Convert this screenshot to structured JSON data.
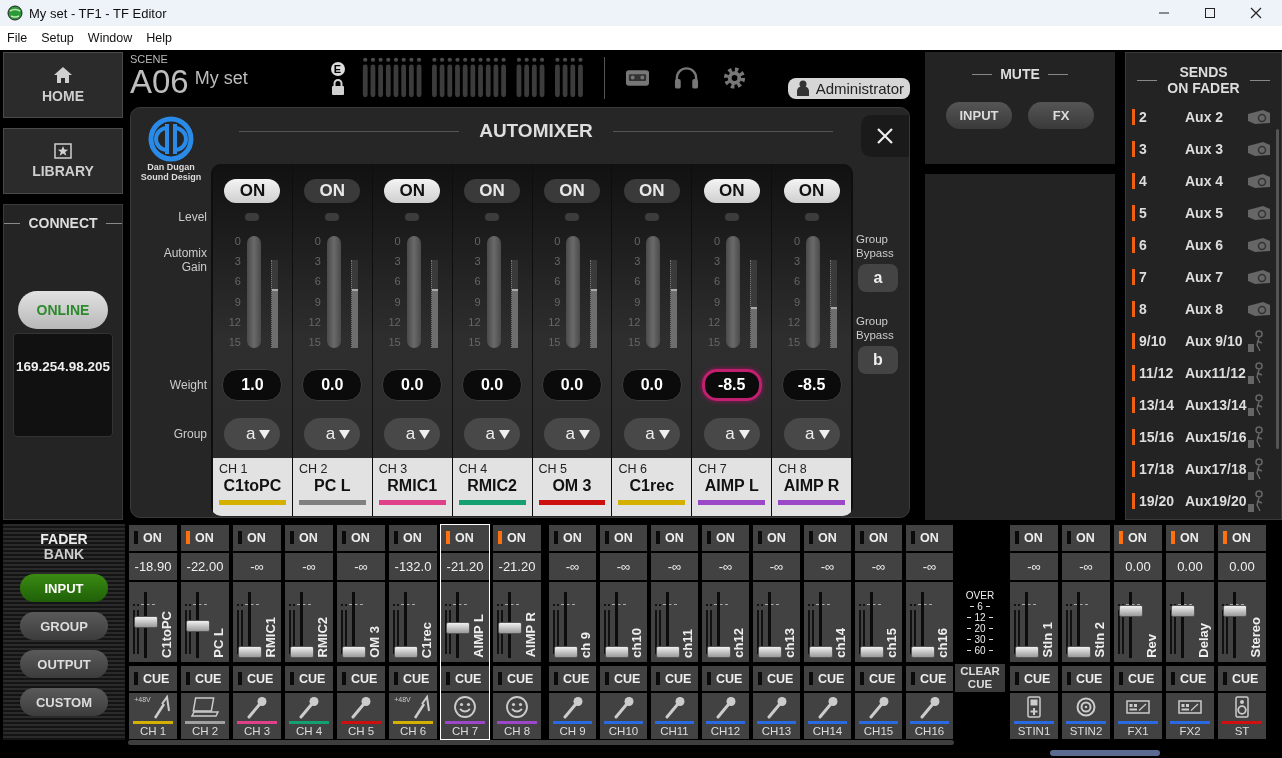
{
  "window": {
    "title": "My set - TF1 - TF Editor"
  },
  "menu": [
    "File",
    "Setup",
    "Window",
    "Help"
  ],
  "nav": [
    {
      "label": "HOME",
      "kind": "home"
    },
    {
      "label": "LIBRARY",
      "kind": "library"
    }
  ],
  "connect": {
    "title": "CONNECT",
    "button": "ONLINE",
    "address": "169.254.98.205"
  },
  "scene": {
    "label": "SCENE",
    "number": "A06",
    "name": "My set",
    "badge": "E"
  },
  "user": {
    "label": "Administrator"
  },
  "automixer": {
    "title": "AUTOMIXER",
    "logo_lines": [
      "Dan Dugan",
      "Sound Design"
    ],
    "row_labels": [
      "Level",
      "Automix Gain",
      "Weight",
      "Group"
    ],
    "channels": [
      {
        "button": "ON",
        "on": true,
        "scale": [
          "0",
          "3",
          "6",
          "9",
          "12",
          "15"
        ],
        "meter": {
          "level": 0.67
        },
        "weight": "1.0",
        "selected": false,
        "group": "a",
        "number": "CH 1",
        "name": "C1toPC",
        "color": "#d4b000"
      },
      {
        "button": "ON",
        "on": false,
        "scale": [
          "0",
          "3",
          "6",
          "9",
          "12",
          "15"
        ],
        "meter": {
          "level": 0.67
        },
        "weight": "0.0",
        "selected": false,
        "group": "a",
        "number": "CH 2",
        "name": "PC L",
        "color": "#808080"
      },
      {
        "button": "ON",
        "on": true,
        "scale": [
          "0",
          "3",
          "6",
          "9",
          "12",
          "15"
        ],
        "meter": {
          "level": 0.67
        },
        "weight": "0.0",
        "selected": false,
        "group": "a",
        "number": "CH 3",
        "name": "RMIC1",
        "color": "#e0408a"
      },
      {
        "button": "ON",
        "on": false,
        "scale": [
          "0",
          "3",
          "6",
          "9",
          "12",
          "15"
        ],
        "meter": {
          "level": 0.67
        },
        "weight": "0.0",
        "selected": false,
        "group": "a",
        "number": "CH 4",
        "name": "RMIC2",
        "color": "#14a070"
      },
      {
        "button": "ON",
        "on": false,
        "scale": [
          "0",
          "3",
          "6",
          "9",
          "12",
          "15"
        ],
        "meter": {
          "level": 0.67
        },
        "weight": "0.0",
        "selected": false,
        "group": "a",
        "number": "CH 5",
        "name": "OM 3",
        "color": "#cc1010"
      },
      {
        "button": "ON",
        "on": false,
        "scale": [
          "0",
          "3",
          "6",
          "9",
          "12",
          "15"
        ],
        "meter": {
          "level": 0.67
        },
        "weight": "0.0",
        "selected": false,
        "group": "a",
        "number": "CH 6",
        "name": "C1rec",
        "color": "#d4b000"
      },
      {
        "button": "ON",
        "on": true,
        "scale": [
          "0",
          "3",
          "6",
          "9",
          "12",
          "15"
        ],
        "meter": {
          "level": 0.47
        },
        "weight": "-8.5",
        "selected": true,
        "group": "a",
        "number": "CH 7",
        "name": "AIMP L",
        "color": "#9a48c8"
      },
      {
        "button": "ON",
        "on": true,
        "scale": [
          "0",
          "3",
          "6",
          "9",
          "12",
          "15"
        ],
        "meter": {
          "level": 0.47
        },
        "weight": "-8.5",
        "selected": false,
        "group": "a",
        "number": "CH 8",
        "name": "AIMP R",
        "color": "#9a48c8"
      }
    ],
    "bypass": [
      {
        "label": "Group Bypass",
        "button": "a"
      },
      {
        "label": "Group Bypass",
        "button": "b"
      }
    ]
  },
  "mute": {
    "title": "MUTE",
    "buttons": [
      "INPUT",
      "FX"
    ]
  },
  "sends": {
    "title": [
      "SENDS",
      "ON FADER"
    ],
    "items": [
      {
        "number": "2",
        "name": "Aux 2",
        "kind": "wedge"
      },
      {
        "number": "3",
        "name": "Aux 3",
        "kind": "wedge"
      },
      {
        "number": "4",
        "name": "Aux 4",
        "kind": "wedge"
      },
      {
        "number": "5",
        "name": "Aux 5",
        "kind": "wedge"
      },
      {
        "number": "6",
        "name": "Aux 6",
        "kind": "wedge"
      },
      {
        "number": "7",
        "name": "Aux 7",
        "kind": "wedge"
      },
      {
        "number": "8",
        "name": "Aux 8",
        "kind": "wedge"
      },
      {
        "number": "9/10",
        "name": "Aux 9/10",
        "kind": "iem"
      },
      {
        "number": "11/12",
        "name": "Aux11/12",
        "kind": "iem"
      },
      {
        "number": "13/14",
        "name": "Aux13/14",
        "kind": "iem"
      },
      {
        "number": "15/16",
        "name": "Aux15/16",
        "kind": "iem"
      },
      {
        "number": "17/18",
        "name": "Aux17/18",
        "kind": "iem"
      },
      {
        "number": "19/20",
        "name": "Aux19/20",
        "kind": "iem"
      }
    ]
  },
  "fader_bank": {
    "title": [
      "FADER",
      "BANK"
    ],
    "buttons": [
      {
        "label": "INPUT",
        "selected": true
      },
      {
        "label": "GROUP",
        "selected": false
      },
      {
        "label": "OUTPUT",
        "selected": false
      },
      {
        "label": "CUSTOM",
        "selected": false
      }
    ]
  },
  "meter_scale": [
    "OVER",
    "6",
    "12",
    "20",
    "30",
    "60"
  ],
  "clear_cue": "CLEAR CUE",
  "strip_banks": [
    {
      "strips": [
        {
          "on_label": "ON",
          "on": false,
          "value": "-18.90",
          "level": 0.55,
          "name": "C1toPC",
          "cue_label": "CUE",
          "cued": false,
          "kind": "phantom-mic",
          "phantom": "+48V",
          "color": "#d4b000",
          "label": "CH 1",
          "selected": false
        },
        {
          "on_label": "ON",
          "on": true,
          "value": "-22.00",
          "level": 0.48,
          "name": "PC L",
          "cue_label": "CUE",
          "cued": false,
          "kind": "laptop",
          "color": "#a0a0a0",
          "label": "CH 2",
          "selected": false
        },
        {
          "on_label": "ON",
          "on": false,
          "value": "-∞",
          "level": 0,
          "name": "RMIC1",
          "cue_label": "CUE",
          "cued": false,
          "kind": "mic",
          "color": "#e0408a",
          "label": "CH 3",
          "selected": false
        },
        {
          "on_label": "ON",
          "on": false,
          "value": "-∞",
          "level": 0,
          "name": "RMIC2",
          "cue_label": "CUE",
          "cued": false,
          "kind": "mic",
          "color": "#14a070",
          "label": "CH 4",
          "selected": false
        },
        {
          "on_label": "ON",
          "on": false,
          "value": "-∞",
          "level": 0,
          "name": "OM 3",
          "cue_label": "CUE",
          "cued": false,
          "kind": "mic",
          "color": "#cc1010",
          "label": "CH 5",
          "selected": false
        },
        {
          "on_label": "ON",
          "on": false,
          "value": "-132.0",
          "level": 0,
          "name": "C1rec",
          "cue_label": "CUE",
          "cued": false,
          "kind": "phantom-mic",
          "phantom": "+48V",
          "color": "#d4b000",
          "label": "CH 6",
          "selected": false
        },
        {
          "on_label": "ON",
          "on": true,
          "value": "-21.20",
          "level": 0.45,
          "name": "AIMP L",
          "cue_label": "CUE",
          "cued": false,
          "kind": "smiley",
          "color": "#9a48c8",
          "label": "CH 7",
          "selected": true
        },
        {
          "on_label": "ON",
          "on": true,
          "value": "-21.20",
          "level": 0.45,
          "name": "AIMP R",
          "cue_label": "CUE",
          "cued": false,
          "kind": "smiley",
          "color": "#9a48c8",
          "label": "CH 8",
          "selected": false
        }
      ]
    },
    {
      "strips": [
        {
          "on_label": "ON",
          "on": false,
          "value": "-∞",
          "level": 0,
          "name": "ch 9",
          "cue_label": "CUE",
          "cued": false,
          "kind": "mic",
          "color": "#2a6ae0",
          "label": "CH 9",
          "selected": false
        },
        {
          "on_label": "ON",
          "on": false,
          "value": "-∞",
          "level": 0,
          "name": "ch10",
          "cue_label": "CUE",
          "cued": false,
          "kind": "mic",
          "color": "#2a6ae0",
          "label": "CH10",
          "selected": false
        },
        {
          "on_label": "ON",
          "on": false,
          "value": "-∞",
          "level": 0,
          "name": "ch11",
          "cue_label": "CUE",
          "cued": false,
          "kind": "mic",
          "color": "#2a6ae0",
          "label": "CH11",
          "selected": false
        },
        {
          "on_label": "ON",
          "on": false,
          "value": "-∞",
          "level": 0,
          "name": "ch12",
          "cue_label": "CUE",
          "cued": false,
          "kind": "mic",
          "color": "#2a6ae0",
          "label": "CH12",
          "selected": false
        },
        {
          "on_label": "ON",
          "on": false,
          "value": "-∞",
          "level": 0,
          "name": "ch13",
          "cue_label": "CUE",
          "cued": false,
          "kind": "mic",
          "color": "#2a6ae0",
          "label": "CH13",
          "selected": false
        },
        {
          "on_label": "ON",
          "on": false,
          "value": "-∞",
          "level": 0,
          "name": "ch14",
          "cue_label": "CUE",
          "cued": false,
          "kind": "mic",
          "color": "#2a6ae0",
          "label": "CH14",
          "selected": false
        },
        {
          "on_label": "ON",
          "on": false,
          "value": "-∞",
          "level": 0,
          "name": "ch15",
          "cue_label": "CUE",
          "cued": false,
          "kind": "mic",
          "color": "#2a6ae0",
          "label": "CH15",
          "selected": false
        },
        {
          "on_label": "ON",
          "on": false,
          "value": "-∞",
          "level": 0,
          "name": "ch16",
          "cue_label": "CUE",
          "cued": false,
          "kind": "mic",
          "color": "#2a6ae0",
          "label": "CH16",
          "selected": false
        }
      ]
    },
    {
      "strips": [
        {
          "on_label": "ON",
          "on": false,
          "value": "-∞",
          "level": 0,
          "name": "StIn 1",
          "cue_label": "CUE",
          "cued": false,
          "kind": "player",
          "color": "#2a6ae0",
          "label": "STIN1",
          "selected": false
        },
        {
          "on_label": "ON",
          "on": false,
          "value": "-∞",
          "level": 0,
          "name": "StIn 2",
          "cue_label": "CUE",
          "cued": false,
          "kind": "disc",
          "color": "#2a6ae0",
          "label": "STIN2",
          "selected": false
        },
        {
          "on_label": "ON",
          "on": true,
          "value": "0.00",
          "level": 0.76,
          "name": "Rev",
          "cue_label": "CUE",
          "cued": false,
          "kind": "effects",
          "color": "#2a6ae0",
          "label": "FX1",
          "selected": false
        },
        {
          "on_label": "ON",
          "on": true,
          "value": "0.00",
          "level": 0.76,
          "name": "Delay",
          "cue_label": "CUE",
          "cued": false,
          "kind": "effects",
          "color": "#2a6ae0",
          "label": "FX2",
          "selected": false
        },
        {
          "on_label": "ON",
          "on": true,
          "value": "0.00",
          "level": 0.76,
          "name": "Stereo",
          "cue_label": "CUE",
          "cued": false,
          "kind": "speaker",
          "color": "#d01010",
          "label": "ST",
          "selected": false
        }
      ]
    }
  ]
}
